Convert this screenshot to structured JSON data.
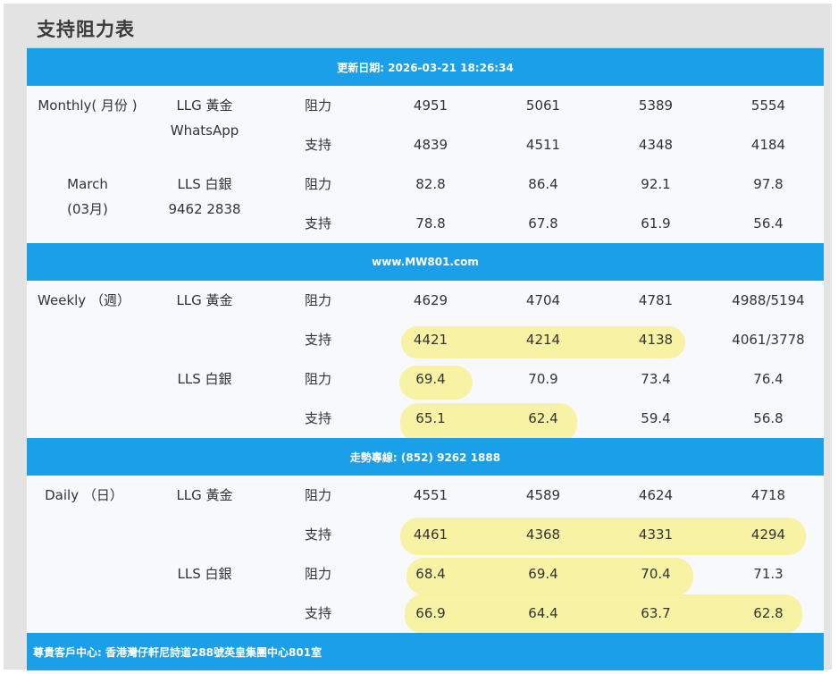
{
  "title": "支持阻力表",
  "colors": {
    "bar": "#1a9fe8",
    "highlight": "#f7f08a"
  },
  "bars": {
    "updated": "更新日期: 2026-03-21 18:26:34",
    "website": "www.MW801.com",
    "hotline": "走勢專線: (852) 9262 1888",
    "address": "尊貴客戶中心: 香港灣仔軒尼詩道288號英皇集團中心801室"
  },
  "monthly": {
    "period_line1": "Monthly( 月份 )",
    "period_line2": "March",
    "period_line3": "(03月)",
    "llg_label": "LLG 黃金",
    "llg_sub": "WhatsApp",
    "lls_label": "LLS 白銀",
    "lls_sub": "9462 2838",
    "rows": [
      {
        "type": "阻力",
        "v": [
          "4951",
          "5061",
          "5389",
          "5554"
        ]
      },
      {
        "type": "支持",
        "v": [
          "4839",
          "4511",
          "4348",
          "4184"
        ]
      },
      {
        "type": "阻力",
        "v": [
          "82.8",
          "86.4",
          "92.1",
          "97.8"
        ]
      },
      {
        "type": "支持",
        "v": [
          "78.8",
          "67.8",
          "61.9",
          "56.4"
        ]
      }
    ]
  },
  "weekly": {
    "period": "Weekly （週）",
    "llg_label": "LLG 黃金",
    "lls_label": "LLS 白銀",
    "rows": [
      {
        "type": "阻力",
        "v": [
          "4629",
          "4704",
          "4781",
          "4988/5194"
        ]
      },
      {
        "type": "支持",
        "v": [
          "4421",
          "4214",
          "4138",
          "4061/3778"
        ]
      },
      {
        "type": "阻力",
        "v": [
          "69.4",
          "70.9",
          "73.4",
          "76.4"
        ]
      },
      {
        "type": "支持",
        "v": [
          "65.1",
          "62.4",
          "59.4",
          "56.8"
        ]
      }
    ]
  },
  "daily": {
    "period": "Daily （日）",
    "llg_label": "LLG 黃金",
    "lls_label": "LLS 白銀",
    "rows": [
      {
        "type": "阻力",
        "v": [
          "4551",
          "4589",
          "4624",
          "4718"
        ]
      },
      {
        "type": "支持",
        "v": [
          "4461",
          "4368",
          "4331",
          "4294"
        ]
      },
      {
        "type": "阻力",
        "v": [
          "68.4",
          "69.4",
          "70.4",
          "71.3"
        ]
      },
      {
        "type": "支持",
        "v": [
          "66.9",
          "64.4",
          "63.7",
          "62.8"
        ]
      }
    ]
  }
}
